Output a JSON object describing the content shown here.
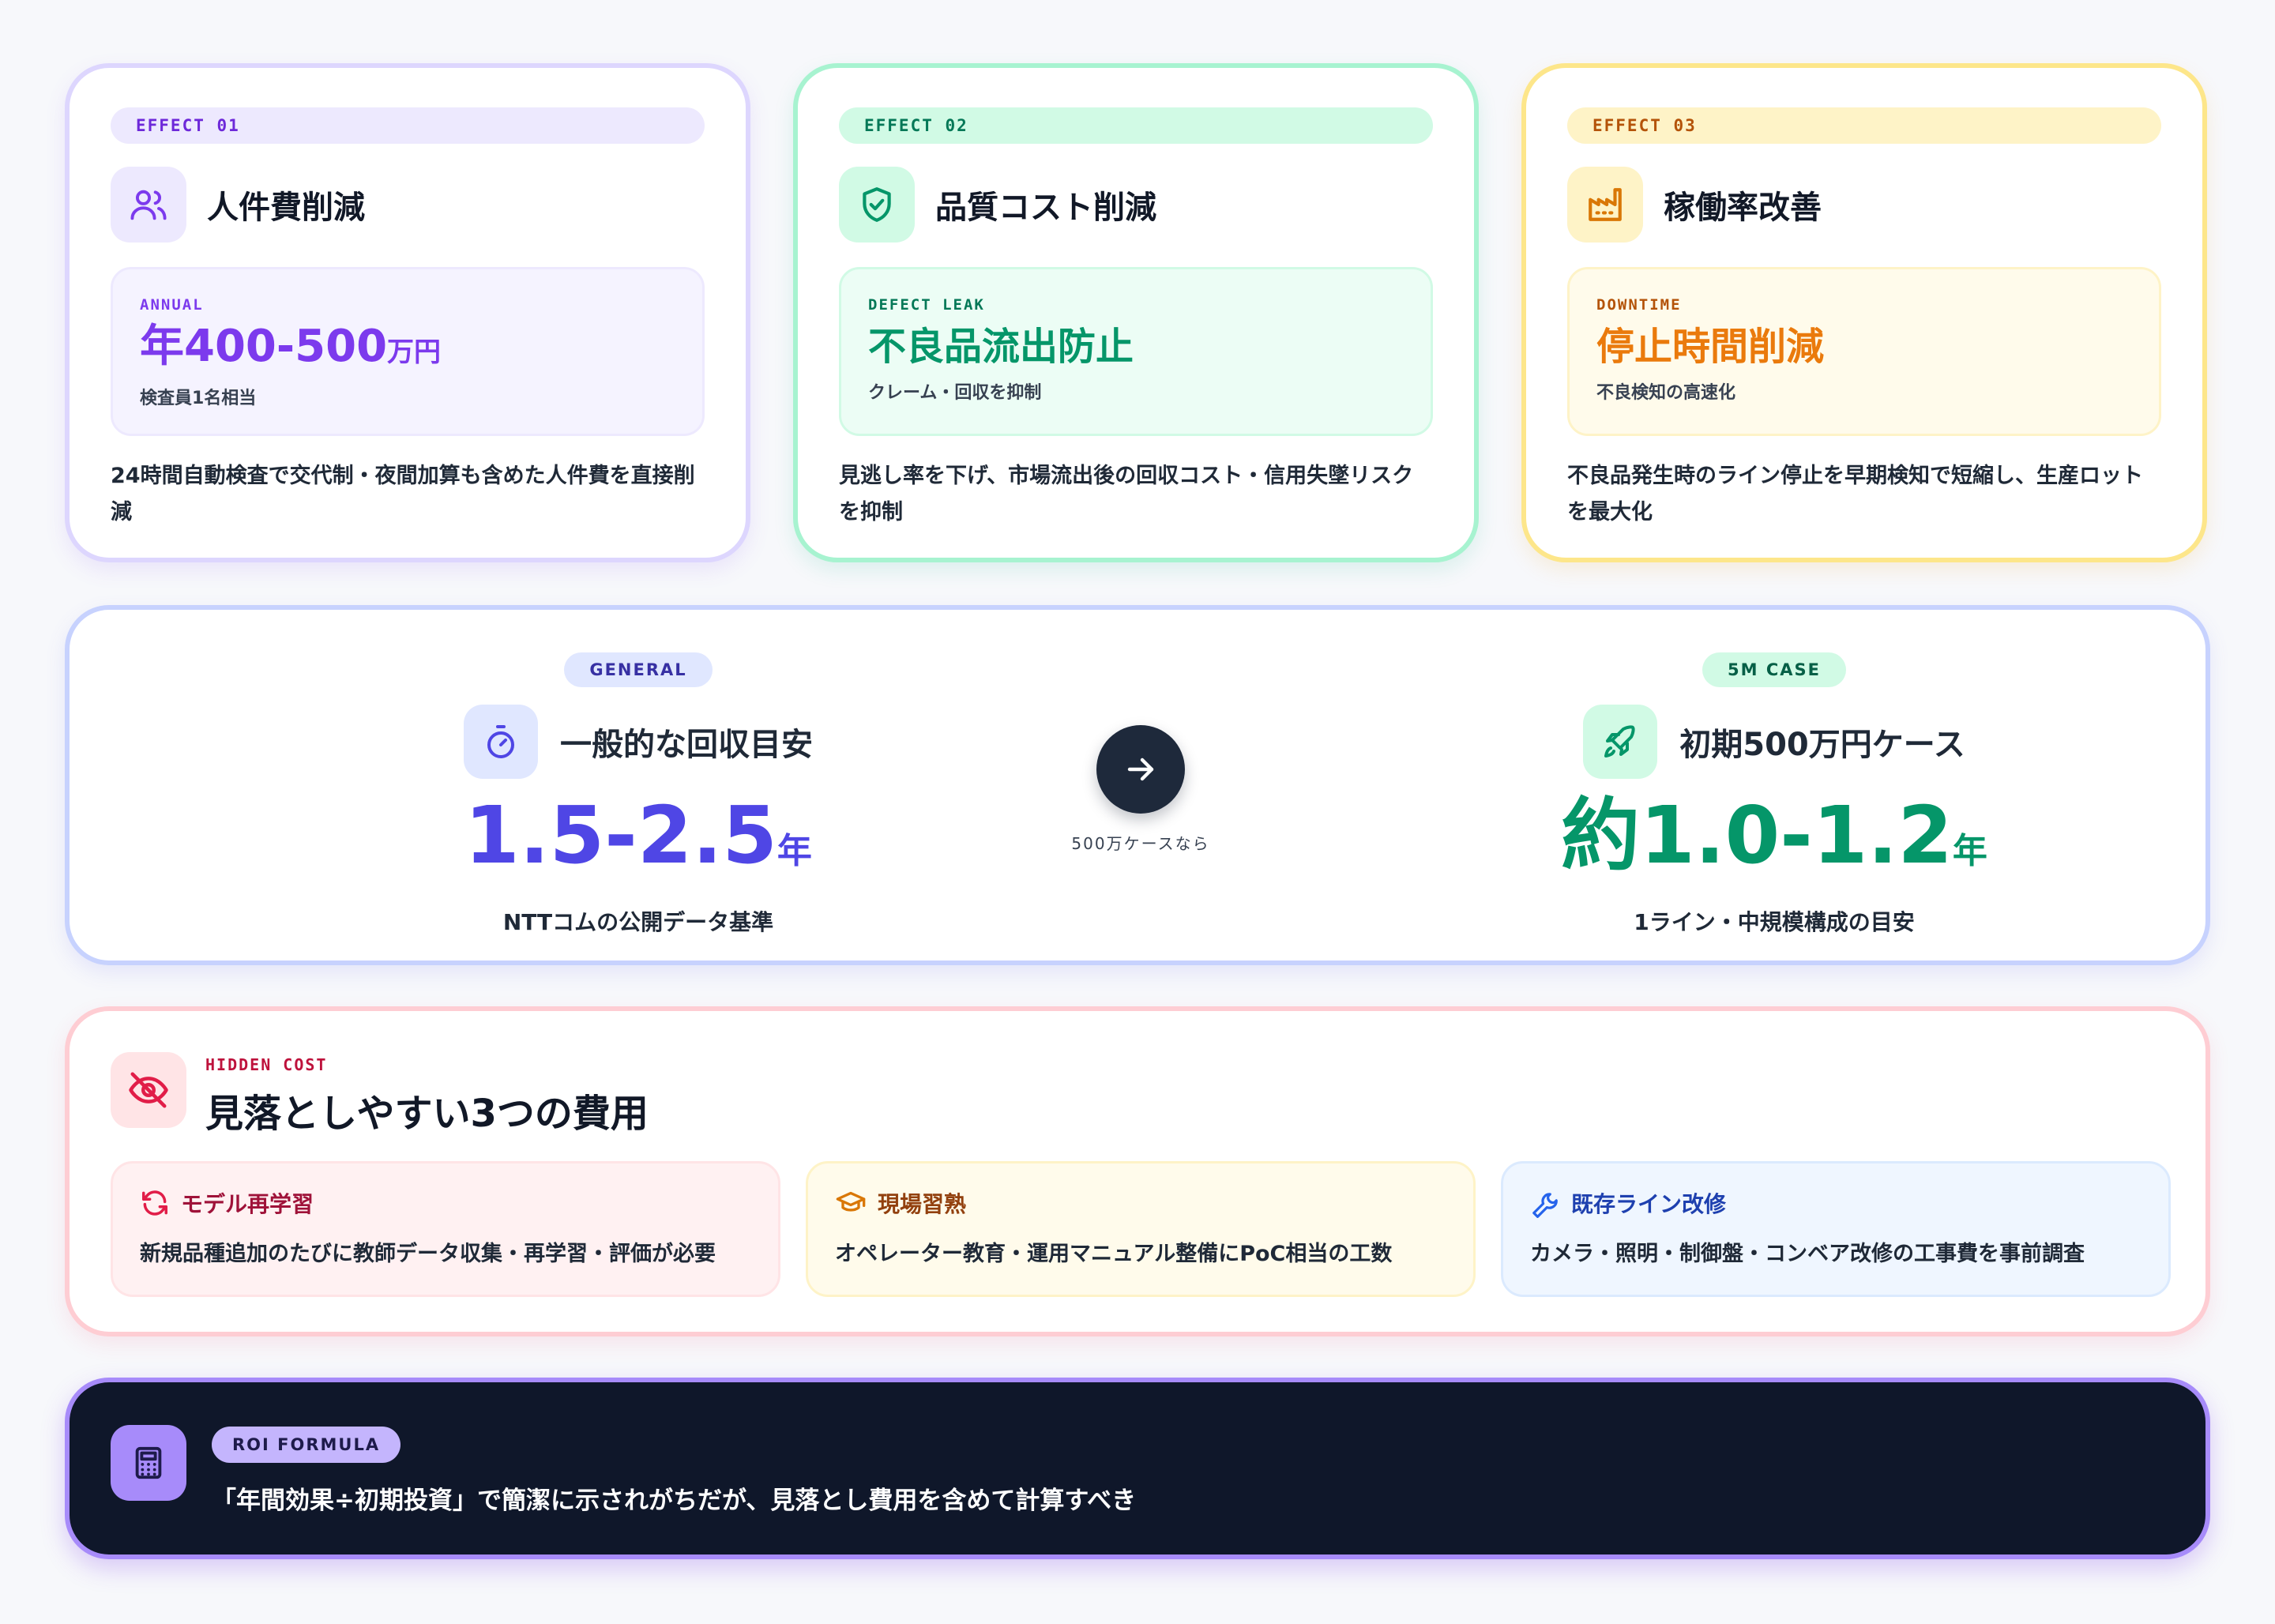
{
  "effects": [
    {
      "tag": "EFFECT 01",
      "icon": "users-icon",
      "title": "人件費削減",
      "metric_label": "ANNUAL",
      "metric_value": "年400-500",
      "metric_unit": "万円",
      "metric_sub": "検査員1名相当",
      "description": "24時間自動検査で交代制・夜間加算も含めた人件費を直接削減",
      "accent": "#7c3aed"
    },
    {
      "tag": "EFFECT 02",
      "icon": "shield-check-icon",
      "title": "品質コスト削減",
      "metric_label": "DEFECT LEAK",
      "metric_value": "不良品流出防止",
      "metric_unit": "",
      "metric_sub": "クレーム・回収を抑制",
      "description": "見逃し率を下げ、市場流出後の回収コスト・信用失墜リスクを抑制",
      "accent": "#059669"
    },
    {
      "tag": "EFFECT 03",
      "icon": "factory-icon",
      "title": "稼働率改善",
      "metric_label": "DOWNTIME",
      "metric_value": "停止時間削減",
      "metric_unit": "",
      "metric_sub": "不良検知の高速化",
      "description": "不良品発生時のライン停止を早期検知で短縮し、生産ロットを最大化",
      "accent": "#ea7a0c"
    }
  ],
  "payback": {
    "general": {
      "tag": "GENERAL",
      "icon": "timer-icon",
      "title": "一般的な回収目安",
      "value": "1.5-2.5",
      "unit": "年",
      "note": "NTTコムの公開データ基準",
      "accent": "#4f46e5"
    },
    "arrow_note": "500万ケースなら",
    "case": {
      "tag": "5M CASE",
      "icon": "rocket-icon",
      "title": "初期500万円ケース",
      "value": "約1.0-1.2",
      "unit": "年",
      "note": "1ライン・中規模構成の目安",
      "accent": "#059669"
    }
  },
  "hidden_costs": {
    "label": "HIDDEN COST",
    "title": "見落としやすい3つの費用",
    "items": [
      {
        "icon": "refresh-icon",
        "name": "モデル再学習",
        "description": "新規品種追加のたびに教師データ収集・再学習・評価が必要"
      },
      {
        "icon": "graduation-cap-icon",
        "name": "現場習熟",
        "description": "オペレーター教育・運用マニュアル整備にPoC相当の工数"
      },
      {
        "icon": "wrench-icon",
        "name": "既存ライン改修",
        "description": "カメラ・照明・制御盤・コンベア改修の工事費を事前調査"
      }
    ]
  },
  "roi": {
    "tag": "ROI FORMULA",
    "icon": "calculator-icon",
    "text": "「年間効果÷初期投資」で簡潔に示されがちだが、見落とし費用を含めて計算すべき"
  }
}
